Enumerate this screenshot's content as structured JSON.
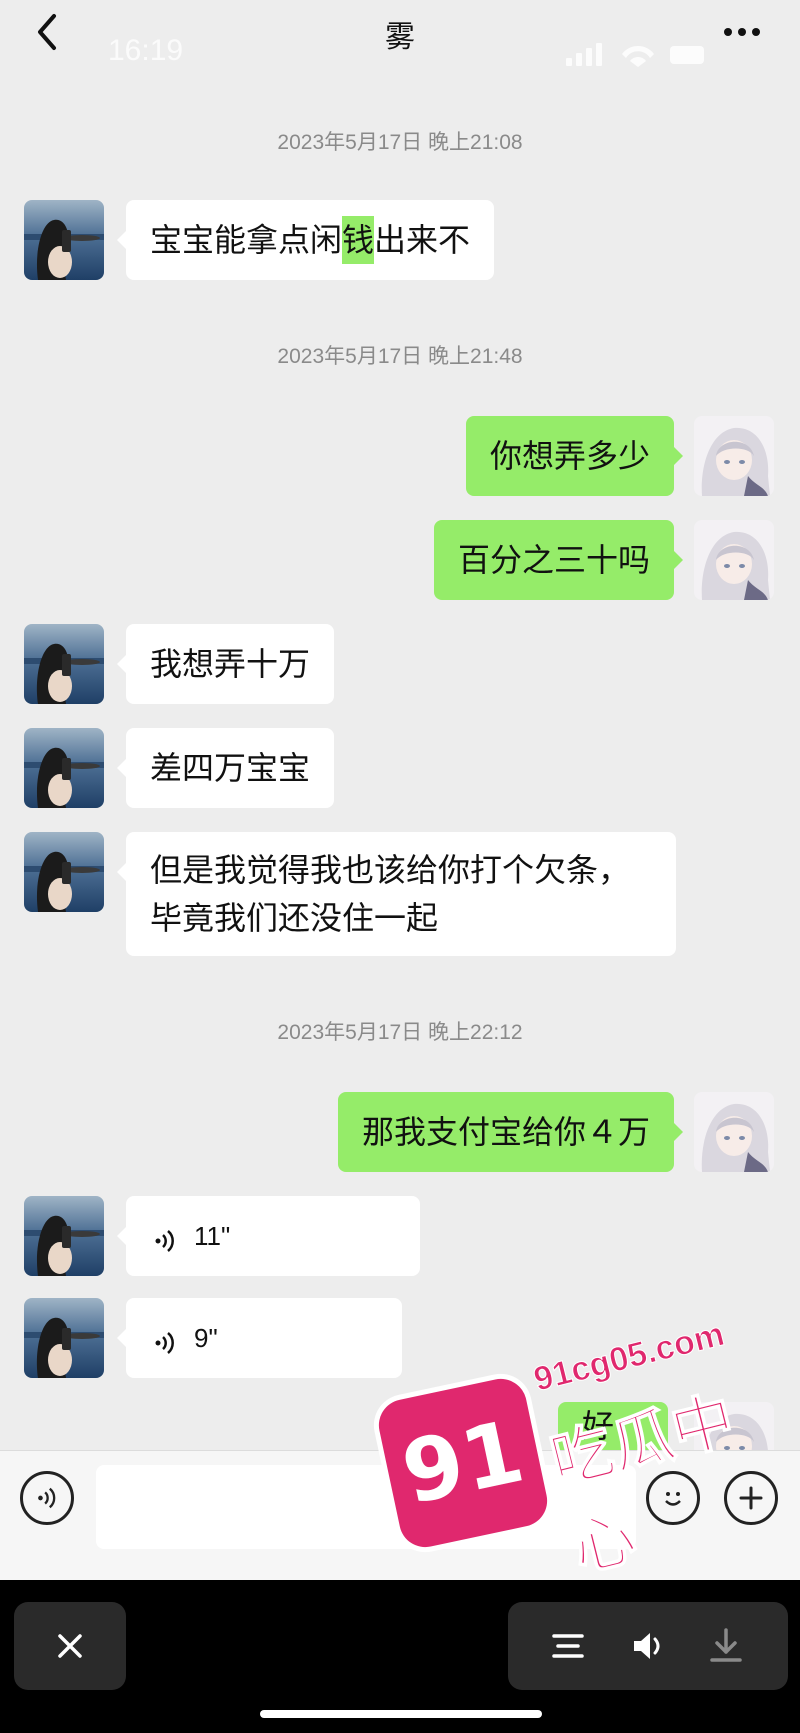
{
  "header": {
    "title": "雾",
    "status_time": "16:19"
  },
  "messages": [
    {
      "type": "timestamp",
      "text": "2023年5月17日 晚上21:08"
    },
    {
      "type": "incoming",
      "text_before": "宝宝能拿点闲",
      "highlight": "钱",
      "text_after": "出来不"
    },
    {
      "type": "timestamp",
      "text": "2023年5月17日 晚上21:48"
    },
    {
      "type": "outgoing",
      "text": "你想弄多少"
    },
    {
      "type": "outgoing",
      "text": "百分之三十吗"
    },
    {
      "type": "incoming",
      "text": "我想弄十万"
    },
    {
      "type": "incoming",
      "text": "差四万宝宝"
    },
    {
      "type": "incoming",
      "lines": [
        "但是我觉得我也该给你打个欠条，",
        "毕竟我们还没住一起"
      ]
    },
    {
      "type": "timestamp",
      "text": "2023年5月17日 晚上22:12"
    },
    {
      "type": "outgoing",
      "text": "那我支付宝给你４万"
    },
    {
      "type": "incoming_voice",
      "duration": "11\""
    },
    {
      "type": "incoming_voice",
      "duration": "9\""
    },
    {
      "type": "outgoing_partial",
      "text": "好"
    }
  ],
  "input_bar": {
    "voice_icon": "voice-mode-icon",
    "emoji_icon": "emoji-icon",
    "plus_icon": "plus-icon"
  },
  "viewer_controls": {
    "close_icon": "close-icon",
    "list_icon": "list-icon",
    "speaker_icon": "speaker-icon",
    "download_icon": "download-icon"
  },
  "watermark": {
    "badge": "91",
    "site": "91cg05.com",
    "name": "吃瓜中心"
  },
  "colors": {
    "background": "#ededed",
    "incoming_bubble": "#ffffff",
    "outgoing_bubble": "#95ec69",
    "timestamp_text": "#8a8a8a",
    "watermark": "#e0286e"
  }
}
